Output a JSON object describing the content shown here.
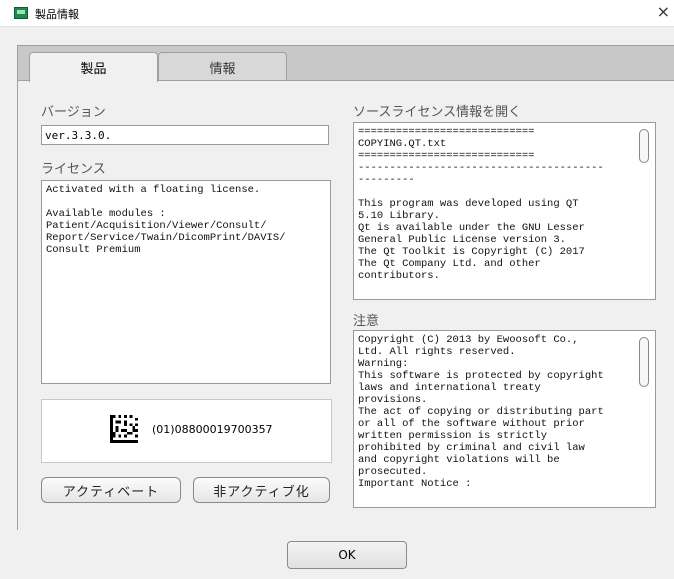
{
  "window": {
    "title": "製品情報",
    "close_glyph": "×"
  },
  "tabs": [
    {
      "label": "製品"
    },
    {
      "label": "情報"
    }
  ],
  "version": {
    "label": "バージョン",
    "value": "ver.3.3.0."
  },
  "license": {
    "label": "ライセンス",
    "text": "Activated with a floating license.\n\nAvailable modules :\nPatient/Acquisition/Viewer/Consult/\nReport/Service/Twain/DicomPrint/DAVIS/\nConsult Premium"
  },
  "barcode": {
    "text": "(01)08800019700357"
  },
  "buttons": {
    "activate": "アクティベート",
    "deactivate": "非アクティブ化",
    "ok": "OK"
  },
  "open_source": {
    "label": "ソースライセンス情報を開く",
    "text": "============================\nCOPYING.QT.txt\n============================\n---------------------------------------\n---------\n\nThis program was developed using QT\n5.10 Library.\nQt is available under the GNU Lesser\nGeneral Public License version 3.\nThe Qt Toolkit is Copyright (C) 2017\nThe Qt Company Ltd. and other\ncontributors."
  },
  "notice": {
    "label": "注意",
    "text": "Copyright (C) 2013 by Ewoosoft Co.,\nLtd. All rights reserved.\nWarning:\nThis software is protected by copyright\nlaws and international treaty\nprovisions.\nThe act of copying or distributing part\nor all of the software without prior\nwritten permission is strictly\nprohibited by criminal and civil law\nand copyright violations will be\nprosecuted.\nImportant Notice :"
  }
}
